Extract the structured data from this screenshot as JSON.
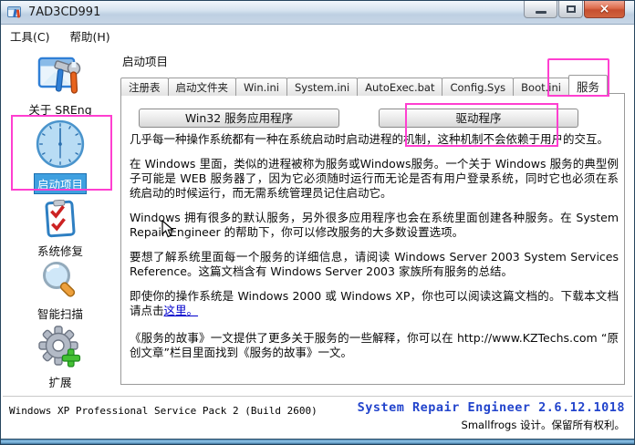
{
  "window": {
    "title": "7AD3CD991",
    "controls": {
      "minimize_icon": "minimize-icon",
      "maximize_icon": "maximize-icon",
      "close_icon": "close-icon",
      "close_glyph": "×"
    }
  },
  "menu": {
    "items": [
      {
        "label": "工具(C)"
      },
      {
        "label": "帮助(H)"
      }
    ]
  },
  "sidebar": {
    "items": [
      {
        "label": "关于 SREng",
        "icon": "window-tools-icon",
        "selected": false
      },
      {
        "label": "启动项目",
        "icon": "clock-icon",
        "selected": true,
        "highlighted": true
      },
      {
        "label": "系统修复",
        "icon": "checklist-icon",
        "selected": false
      },
      {
        "label": "智能扫描",
        "icon": "magnifier-icon",
        "selected": false
      },
      {
        "label": "扩展",
        "icon": "gear-plus-icon",
        "selected": false
      }
    ]
  },
  "content": {
    "header": "启动项目",
    "tabs": [
      {
        "label": "注册表",
        "active": false
      },
      {
        "label": "启动文件夹",
        "active": false
      },
      {
        "label": "Win.ini",
        "active": false
      },
      {
        "label": "System.ini",
        "active": false
      },
      {
        "label": "AutoExec.bat",
        "active": false
      },
      {
        "label": "Config.Sys",
        "active": false
      },
      {
        "label": "Boot.ini",
        "active": false
      },
      {
        "label": "服务",
        "active": true,
        "highlighted": true
      }
    ],
    "buttons": [
      {
        "label": "Win32 服务应用程序"
      },
      {
        "label": "驱动程序",
        "highlighted": true
      }
    ],
    "paragraphs": [
      "几乎每一种操作系统都有一种在系统启动时启动进程的机制，这种机制不会依赖于用户的交互。",
      "在 Windows 里面，类似的进程被称为服务或Windows服务。一个关于 Windows 服务的典型例子可能是 WEB 服务器了，因为它必须随时运行而无论是否有用户登录系统，同时它也必须在系统启动的时候运行，而无需系统管理员记住启动它。",
      "Windows 拥有很多的默认服务，另外很多应用程序也会在系统里面创建各种服务。在 System Repair Engineer 的帮助下，你可以修改服务的大多数设置选项。",
      "要想了解系统里面每一个服务的详细信息，请阅读 Windows Server 2003 System Services Reference。这篇文档含有 Windows Server 2003 家族所有服务的总结。"
    ],
    "p5_prefix": "即使你的操作系统是 Windows 2000 或 Windows XP，你也可以阅读这篇文档的。下载本文档请点击",
    "p5_link": "这里。",
    "p6": "《服务的故事》一文提供了更多关于服务的一些解释，你可以在 http://www.KZTechs.com “原创文章”栏目里面找到《服务的故事》一文。"
  },
  "statusbar": {
    "os": "Windows XP Professional Service Pack 2 (Build 2600)",
    "app": "System Repair Engineer 2.6.12.1018",
    "credit": "Smallfrogs 设计。保留所有权利。"
  },
  "colors": {
    "highlight_pink": "#ff3fd0",
    "brand_blue": "#2244cc",
    "link_blue": "#0000cc",
    "selected_item_bg": "#3fa0e0"
  }
}
